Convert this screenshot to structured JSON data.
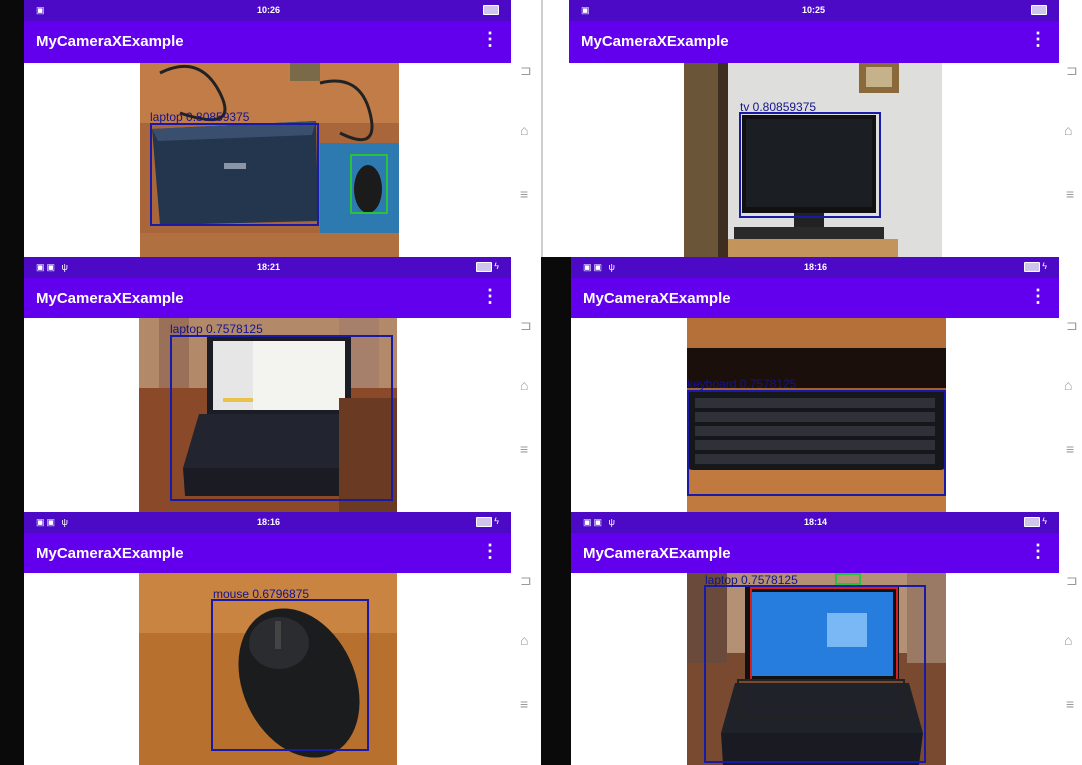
{
  "app": {
    "title": "MyCameraXExample",
    "overflow_icon": "vertical-dots-icon"
  },
  "colors": {
    "status_bar": "#4c0ac7",
    "app_bar": "#6200ee",
    "box": "#1a1aa8",
    "mouse_box": "#27c33a",
    "screen_box": "#d81f1f"
  },
  "navigation_icons": [
    "back-icon",
    "home-icon",
    "recents-icon"
  ],
  "screens": [
    {
      "time": "10:26",
      "detection": "laptop 0.80859375"
    },
    {
      "time": "10:25",
      "detection": "tv 0.80859375"
    },
    {
      "time": "18:21",
      "detection": "laptop 0.7578125"
    },
    {
      "time": "18:16",
      "detection": "keyboard 0.7578125"
    },
    {
      "time": "18:16",
      "detection": "mouse 0.6796875"
    },
    {
      "time": "18:14",
      "detection": "laptop 0.7578125"
    }
  ]
}
